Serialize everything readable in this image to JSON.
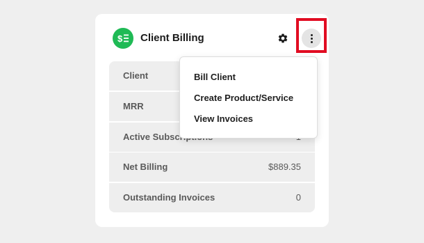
{
  "card": {
    "title": "Client Billing",
    "icon_name": "billing-icon",
    "icon_color": "#1fba55",
    "settings_icon": "gear-icon",
    "menu_icon": "more-vertical-icon"
  },
  "stats": [
    {
      "label": "Client",
      "value": ""
    },
    {
      "label": "MRR",
      "value": ""
    },
    {
      "label": "Active Subscriptions",
      "value": "1"
    },
    {
      "label": "Net Billing",
      "value": "$889.35"
    },
    {
      "label": "Outstanding Invoices",
      "value": "0"
    }
  ],
  "menu": {
    "open": true,
    "items": [
      {
        "label": "Bill Client"
      },
      {
        "label": "Create Product/Service"
      },
      {
        "label": "View Invoices"
      }
    ]
  },
  "highlight_color": "#e10c22"
}
